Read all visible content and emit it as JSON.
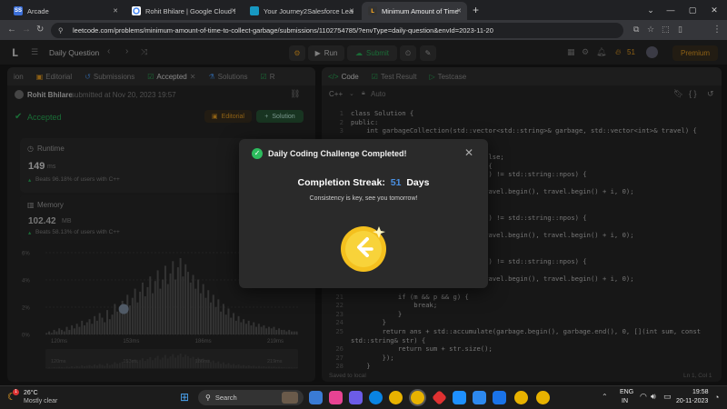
{
  "browser": {
    "tabs": [
      {
        "title": "Arcade",
        "icon": "arcade-icon",
        "color": "#3b6fd8",
        "glyph": "SS"
      },
      {
        "title": "Rohit Bhilare | Google Cloud Sk",
        "icon": "google-cloud-icon",
        "color": "#4285f4",
        "glyph": ""
      },
      {
        "title": "Your Journey2Salesforce Learn",
        "icon": "salesforce-icon",
        "color": "#1798c1",
        "glyph": ""
      },
      {
        "title": "Minimum Amount of Time to C",
        "icon": "leetcode-icon",
        "color": "#f5a623",
        "glyph": ""
      }
    ],
    "url": "leetcode.com/problems/minimum-amount-of-time-to-collect-garbage/submissions/1102754785/?envType=daily-question&envId=2023-11-20"
  },
  "header": {
    "title": "Daily Question",
    "run_label": "Run",
    "submit_label": "Submit",
    "streak_count": "51",
    "premium_label": "Premium"
  },
  "left": {
    "tabs": [
      "ion",
      "Editorial",
      "Submissions",
      "Accepted",
      "Solutions",
      "R"
    ],
    "submitter": "Rohit Bhilare",
    "submitted_text": "submitted at Nov 20, 2023 19:57",
    "status": "Accepted",
    "editorial_label": "Editorial",
    "solution_label": "Solution",
    "runtime_label": "Runtime",
    "runtime_value": "149",
    "runtime_unit": "ms",
    "runtime_beats": "Beats 96.18% of users with C++",
    "memory_label": "Memory",
    "memory_value": "102.42",
    "memory_unit": "MB",
    "memory_beats": "Beats 58.13% of users with C++",
    "y_ticks": [
      "6%",
      "4%",
      "2%",
      "0%"
    ],
    "x_ticks": [
      "120ms",
      "153ms",
      "186ms",
      "219ms"
    ],
    "x_ticks_mini": [
      "120ms",
      "153ms",
      "186ms",
      "219ms"
    ],
    "hist": [
      1,
      2,
      1,
      3,
      2,
      4,
      3,
      2,
      5,
      3,
      6,
      4,
      7,
      5,
      9,
      6,
      8,
      10,
      7,
      12,
      9,
      14,
      11,
      8,
      16,
      10,
      13,
      20,
      15,
      18,
      22,
      17,
      26,
      19,
      24,
      30,
      21,
      28,
      34,
      25,
      31,
      38,
      27,
      35,
      42,
      30,
      36,
      45,
      33,
      40,
      48,
      36,
      44,
      50,
      38,
      46,
      41,
      34,
      39,
      30,
      36,
      27,
      33,
      24,
      29,
      21,
      26,
      18,
      23,
      15,
      20,
      13,
      17,
      11,
      14,
      9,
      12,
      8,
      10,
      7,
      9,
      6,
      8,
      5,
      7,
      5,
      6,
      4,
      5,
      4,
      5,
      3,
      4,
      3,
      3,
      2,
      3,
      2,
      2,
      2
    ],
    "marker_fraction": 0.31
  },
  "code": {
    "tab_code": "Code",
    "tab_test": "Test Result",
    "tab_case": "Testcase",
    "lang": "C++",
    "mode": "Auto",
    "saved": "Saved to local",
    "cursor": "Ln 1, Col 1",
    "lines": [
      {
        "n": "1",
        "t": "class Solution {"
      },
      {
        "n": "2",
        "t": "public:"
      },
      {
        "n": "3",
        "t": "    int garbageCollection(std::vector<std::string>& garbage, std::vector<int>& travel) {"
      },
      {
        "n": "",
        "t": ""
      },
      {
        "n": "",
        "t": ""
      },
      {
        "n": "",
        "t": "                               = false;"
      },
      {
        "n": "",
        "t": "                               -1) {"
      },
      {
        "n": "",
        "t": "                               ('G') != std::string::npos) {"
      },
      {
        "n": "",
        "t": ""
      },
      {
        "n": "",
        "t": "                               e(travel.begin(), travel.begin() + i, 0);"
      },
      {
        "n": "",
        "t": ""
      },
      {
        "n": "",
        "t": ""
      },
      {
        "n": "",
        "t": "                               ('M') != std::string::npos) {"
      },
      {
        "n": "",
        "t": ""
      },
      {
        "n": "",
        "t": "                               e(travel.begin(), travel.begin() + i, 0);"
      },
      {
        "n": "",
        "t": ""
      },
      {
        "n": "",
        "t": ""
      },
      {
        "n": "",
        "t": "                               ('P') != std::string::npos) {"
      },
      {
        "n": "",
        "t": ""
      },
      {
        "n": "",
        "t": "                               e(travel.begin(), travel.begin() + i, 0);"
      },
      {
        "n": "",
        "t": ""
      },
      {
        "n": "21",
        "t": "            if (m && p && g) {"
      },
      {
        "n": "22",
        "t": "                break;"
      },
      {
        "n": "23",
        "t": "            }"
      },
      {
        "n": "24",
        "t": "        }"
      },
      {
        "n": "25",
        "t": "        return ans + std::accumulate(garbage.begin(), garbage.end(), 0, [](int sum, const"
      },
      {
        "n": "",
        "t": "std::string& str) {"
      },
      {
        "n": "26",
        "t": "            return sum + str.size();"
      },
      {
        "n": "27",
        "t": "        });"
      },
      {
        "n": "28",
        "t": "    }"
      }
    ]
  },
  "modal": {
    "title": "Daily Coding Challenge Completed!",
    "streak_label": "Completion Streak:",
    "streak_value": "51",
    "streak_unit": "Days",
    "message": "Consistency is key, see you tomorrow!"
  },
  "taskbar": {
    "temp": "26°C",
    "weather": "Mostly clear",
    "search": "Search",
    "lang1": "ENG",
    "lang2": "IN",
    "time": "19:58",
    "date": "20-11-2023",
    "weather_badge": "1"
  }
}
